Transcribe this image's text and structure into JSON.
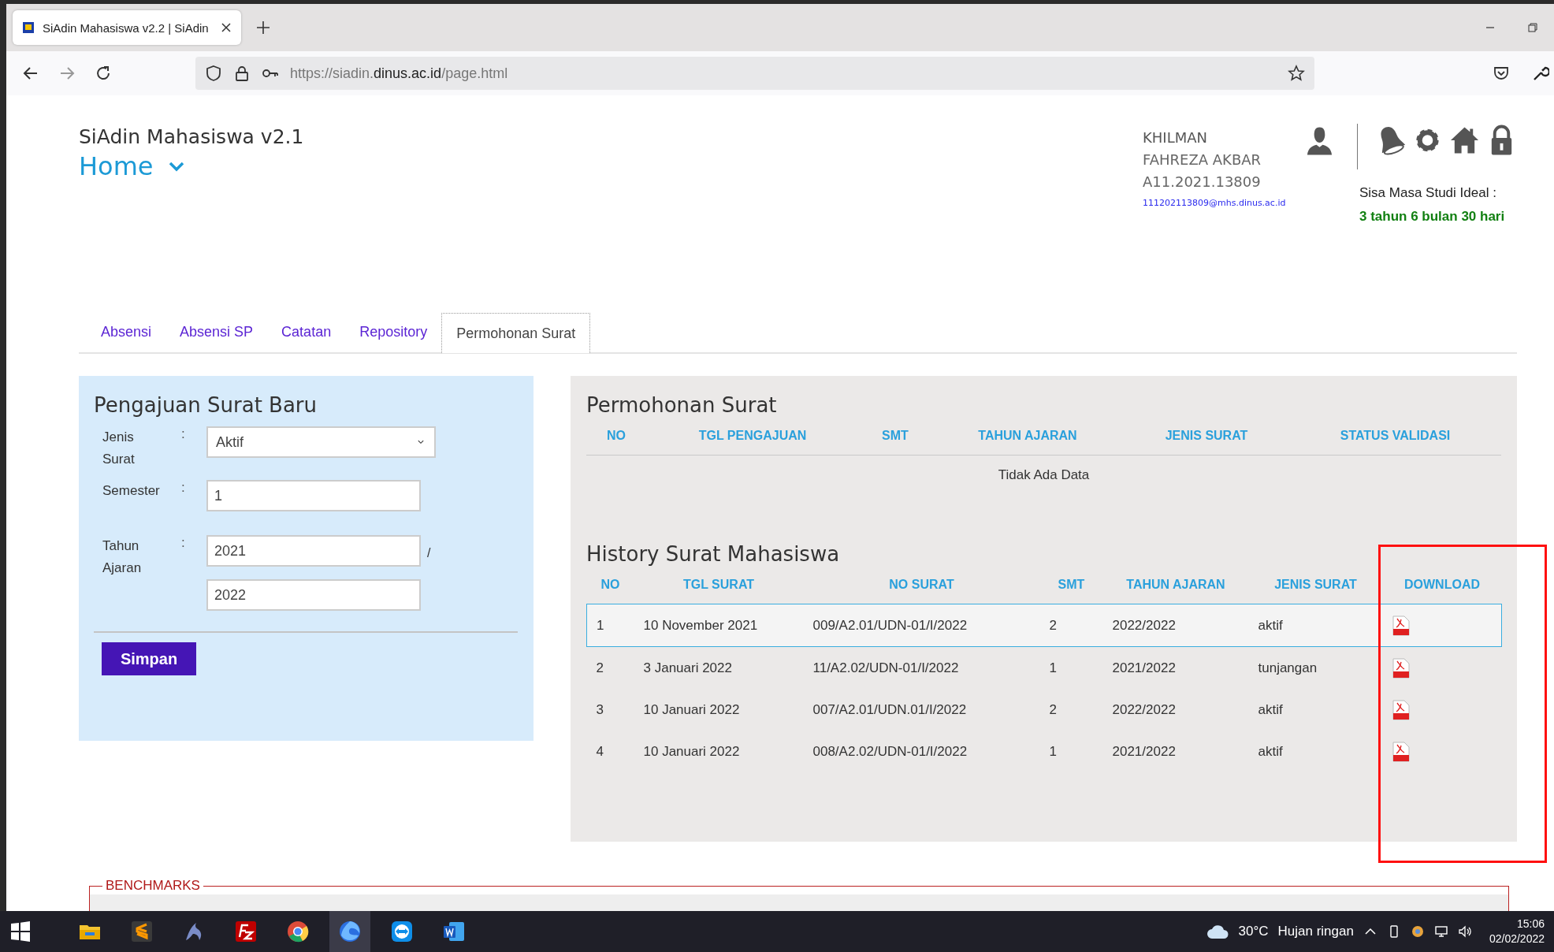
{
  "browser": {
    "tab_title": "SiAdin Mahasiswa v2.2 | SiAdin",
    "url_host": "https://siadin.",
    "url_domain": "dinus.ac.id",
    "url_path": "/page.html"
  },
  "header": {
    "app_title": "SiAdin Mahasiswa v2.1",
    "page_title": "Home",
    "user": {
      "first_name": "KHILMAN",
      "last_name": "FAHREZA AKBAR",
      "nim": "A11.2021.13809",
      "email": "111202113809@mhs.dinus.ac.id"
    },
    "study_label": "Sisa Masa Studi Ideal :",
    "study_value": "3 tahun 6 bulan 30 hari"
  },
  "tabs": [
    {
      "label": "Absensi",
      "selected": false
    },
    {
      "label": "Absensi SP",
      "selected": false
    },
    {
      "label": "Catatan",
      "selected": false
    },
    {
      "label": "Repository",
      "selected": false
    },
    {
      "label": "Permohonan Surat",
      "selected": true
    }
  ],
  "form": {
    "title": "Pengajuan Surat Baru",
    "fields": [
      {
        "kind": "select",
        "label": "Jenis Surat",
        "colon": ":",
        "value": "Aktif"
      },
      {
        "kind": "input",
        "label": "Semester",
        "colon": ":",
        "value": "1"
      },
      {
        "kind": "range",
        "label": "Tahun Ajaran",
        "colon": ":",
        "values": [
          "2021",
          "2022"
        ],
        "separator": "/"
      }
    ],
    "submit": "Simpan"
  },
  "requests": {
    "title": "Permohonan Surat",
    "columns": [
      "NO",
      "TGL PENGAJUAN",
      "SMT",
      "TAHUN AJARAN",
      "JENIS SURAT",
      "STATUS VALIDASI"
    ],
    "empty_text": "Tidak Ada Data"
  },
  "history": {
    "title": "History Surat Mahasiswa",
    "highlight_download": true,
    "columns": [
      "NO",
      "TGL SURAT",
      "NO SURAT",
      "SMT",
      "TAHUN AJARAN",
      "JENIS SURAT",
      "DOWNLOAD"
    ],
    "rows": [
      {
        "selected": true,
        "cells": [
          "1",
          "10 November 2021",
          "009/A2.01/UDN-01/I/2022",
          "2",
          "2022/2022",
          "aktif"
        ]
      },
      {
        "selected": false,
        "cells": [
          "2",
          "3 Januari 2022",
          "11/A2.02/UDN-01/I/2022",
          "1",
          "2021/2022",
          "tunjangan"
        ]
      },
      {
        "selected": false,
        "cells": [
          "3",
          "10 Januari 2022",
          "007/A2.01/UDN.01/I/2022",
          "2",
          "2022/2022",
          "aktif"
        ]
      },
      {
        "selected": false,
        "cells": [
          "4",
          "10 Januari 2022",
          "008/A2.02/UDN-01/I/2022",
          "1",
          "2021/2022",
          "aktif"
        ]
      }
    ]
  },
  "benchmarks": {
    "legend": "BENCHMARKS"
  },
  "taskbar": {
    "apps": [
      {
        "kind": "start",
        "selected": false
      },
      {
        "kind": "folder",
        "selected": false
      },
      {
        "kind": "editor",
        "selected": false
      },
      {
        "kind": "dolphin",
        "selected": false
      },
      {
        "kind": "ftp",
        "selected": false
      },
      {
        "kind": "chrome",
        "selected": false
      },
      {
        "kind": "firefox",
        "selected": true
      },
      {
        "kind": "remote",
        "selected": false
      },
      {
        "kind": "word",
        "selected": false
      }
    ],
    "temperature": "30°C",
    "weather": "Hujan ringan",
    "time": "15:06",
    "date": "02/02/2022"
  }
}
